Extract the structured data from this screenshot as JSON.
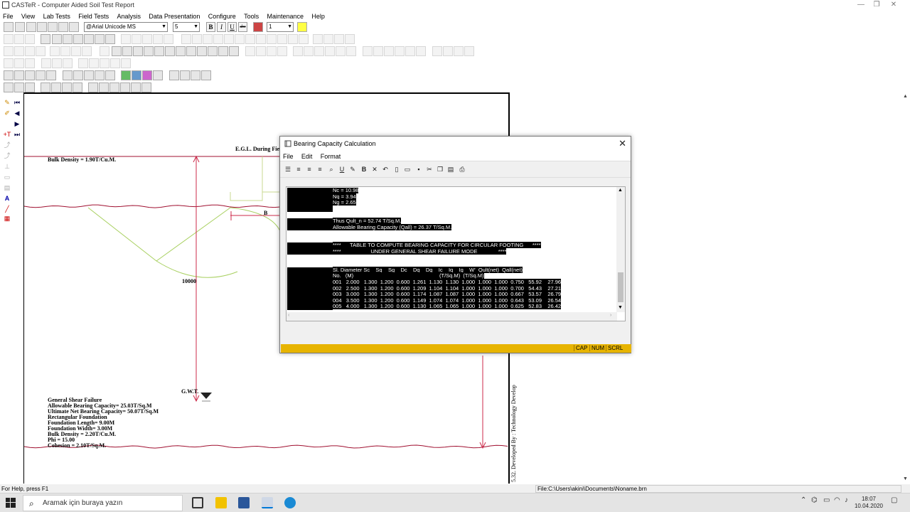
{
  "app": {
    "title": "CASTeR - Computer Aided Soil Test Report"
  },
  "menu": [
    "File",
    "View",
    "Lab Tests",
    "Field Tests",
    "Analysis",
    "Data Presentation",
    "Configure",
    "Tools",
    "Maintenance",
    "Help"
  ],
  "toolbar": {
    "font_name": "@Arial Unicode MS",
    "font_size": "5",
    "bold": "B",
    "italic": "I",
    "underline": "U",
    "strike": "abc",
    "line_width": "1"
  },
  "drawing": {
    "egl_label": "E.G.L. During Fie",
    "bulk_density_top": "Bulk Density = 1.90T/Cu.M.",
    "b_label": "B",
    "depth_label": "10000",
    "gwt_label": "G.W.T.",
    "summary": [
      "General Shear Failure",
      "Allowable Bearing Capacity= 25.03T/Sq.M",
      "Ultimate Net Bearing Capacity= 50.07T/Sq.M",
      "Rectangular Foundation",
      "Foundation Length= 9.00M",
      "Foundation Width= 3.00M",
      "Bulk Density = 2.20T/Cu.M.",
      "Phi = 15.00",
      "Cohesion = 2.10T/Sq.M."
    ],
    "vertical_caption": "5.32. Developed By : Technology Develop"
  },
  "statusbar": {
    "help": "For Help, press F1",
    "path": "File:C:\\Users\\akini\\Documents\\Noname.brn"
  },
  "dialog": {
    "title": "Bearing Capacity Calculation",
    "menu": [
      "File",
      "Edit",
      "Format"
    ],
    "lines": [
      "Nc = 10.98",
      "Nq = 3.94",
      "Ng = 2.65",
      "",
      "",
      "Thus Qult_n = 52.74 T/Sq.M.",
      "Allowable Bearing Capacity (Qall) = 26.37 T/Sq.M.",
      "",
      "",
      "****      TABLE TO COMPUTE BEARING CAPACITY FOR CIRCULAR FOOTING      ****",
      "****                    UNDER GENERAL SHEAR FAILURE MODE              ****",
      "",
      "",
      "Sl. Diameter Sc    Sq    Sg    Dc    Dq    Dg    Ic    Iq    Ig    W'  Qult(net)  Qall(net)",
      "No.   (M)                                                          (T/Sq.M)  (T/Sq.M)",
      "001   2.000   1.300  1.200  0.600  1.261  1.130  1.130  1.000  1.000  1.000  0.750   55.92    27.96",
      "002   2.500   1.300  1.200  0.600  1.209  1.104  1.104  1.000  1.000  1.000  0.700   54.43    27.21",
      "003   3.000   1.300  1.200  0.600  1.174  1.087  1.087  1.000  1.000  1.000  0.667   53.57    26.79",
      "004   3.500   1.300  1.200  0.600  1.149  1.074  1.074  1.000  1.000  1.000  0.643   53.09    26.54",
      "005   4.000   1.300  1.200  0.600  1.130  1.065  1.065  1.000  1.000  1.000  0.625   52.83    26.42"
    ],
    "status": {
      "cap": "CAP",
      "num": "NUM",
      "scrl": "SCRL"
    },
    "status_color": "#e7b400"
  },
  "taskbar": {
    "search_placeholder": "Aramak için buraya yazın",
    "time": "18:07",
    "date": "10.04.2020"
  },
  "colors": {
    "ground_line": "#a01030",
    "failure_curve": "#a8d060",
    "foundation": "#c8d890"
  }
}
